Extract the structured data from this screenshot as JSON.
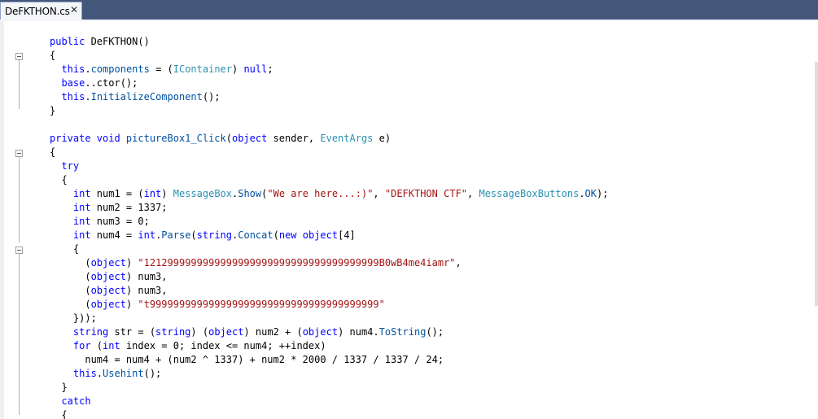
{
  "tab": {
    "title": "DeFKTHON.cs",
    "close_glyph": "✕"
  },
  "code_lines": [
    [
      {
        "c": "kw",
        "t": "public "
      },
      {
        "c": "",
        "t": "DeFKTHON()"
      }
    ],
    [
      {
        "c": "",
        "t": "{"
      }
    ],
    [
      {
        "c": "kw",
        "t": "  this"
      },
      {
        "c": "",
        "t": "."
      },
      {
        "c": "mem",
        "t": "components"
      },
      {
        "c": "",
        "t": " = ("
      },
      {
        "c": "typ",
        "t": "IContainer"
      },
      {
        "c": "",
        "t": ") "
      },
      {
        "c": "kw",
        "t": "null"
      },
      {
        "c": "",
        "t": ";"
      }
    ],
    [
      {
        "c": "kw",
        "t": "  base"
      },
      {
        "c": "",
        "t": "..ctor();"
      }
    ],
    [
      {
        "c": "kw",
        "t": "  this"
      },
      {
        "c": "",
        "t": "."
      },
      {
        "c": "mem",
        "t": "InitializeComponent"
      },
      {
        "c": "",
        "t": "();"
      }
    ],
    [
      {
        "c": "",
        "t": "}"
      }
    ],
    [
      {
        "c": "",
        "t": ""
      }
    ],
    [
      {
        "c": "kw",
        "t": "private void "
      },
      {
        "c": "mem",
        "t": "pictureBox1_Click"
      },
      {
        "c": "",
        "t": "("
      },
      {
        "c": "kw",
        "t": "object"
      },
      {
        "c": "",
        "t": " sender, "
      },
      {
        "c": "typ",
        "t": "EventArgs"
      },
      {
        "c": "",
        "t": " e)"
      }
    ],
    [
      {
        "c": "",
        "t": "{"
      }
    ],
    [
      {
        "c": "kw",
        "t": "  try"
      }
    ],
    [
      {
        "c": "",
        "t": "  {"
      }
    ],
    [
      {
        "c": "kw",
        "t": "    int"
      },
      {
        "c": "",
        "t": " num1 = ("
      },
      {
        "c": "kw",
        "t": "int"
      },
      {
        "c": "",
        "t": ") "
      },
      {
        "c": "typ",
        "t": "MessageBox"
      },
      {
        "c": "",
        "t": "."
      },
      {
        "c": "mem",
        "t": "Show"
      },
      {
        "c": "",
        "t": "("
      },
      {
        "c": "str",
        "t": "\"We are here...:)\""
      },
      {
        "c": "",
        "t": ", "
      },
      {
        "c": "str",
        "t": "\"DEFKTHON CTF\""
      },
      {
        "c": "",
        "t": ", "
      },
      {
        "c": "typ",
        "t": "MessageBoxButtons"
      },
      {
        "c": "",
        "t": "."
      },
      {
        "c": "mem",
        "t": "OK"
      },
      {
        "c": "",
        "t": ");"
      }
    ],
    [
      {
        "c": "kw",
        "t": "    int"
      },
      {
        "c": "",
        "t": " num2 = 1337;"
      }
    ],
    [
      {
        "c": "kw",
        "t": "    int"
      },
      {
        "c": "",
        "t": " num3 = 0;"
      }
    ],
    [
      {
        "c": "kw",
        "t": "    int"
      },
      {
        "c": "",
        "t": " num4 = "
      },
      {
        "c": "kw",
        "t": "int"
      },
      {
        "c": "",
        "t": "."
      },
      {
        "c": "mem",
        "t": "Parse"
      },
      {
        "c": "",
        "t": "("
      },
      {
        "c": "kw",
        "t": "string"
      },
      {
        "c": "",
        "t": "."
      },
      {
        "c": "mem",
        "t": "Concat"
      },
      {
        "c": "",
        "t": "("
      },
      {
        "c": "kw",
        "t": "new object"
      },
      {
        "c": "",
        "t": "[4]"
      }
    ],
    [
      {
        "c": "",
        "t": "    {"
      }
    ],
    [
      {
        "c": "",
        "t": "      ("
      },
      {
        "c": "kw",
        "t": "object"
      },
      {
        "c": "",
        "t": ") "
      },
      {
        "c": "str",
        "t": "\"1212999999999999999999999999999999999999B0wB4me4iamr\""
      },
      {
        "c": "",
        "t": ","
      }
    ],
    [
      {
        "c": "",
        "t": "      ("
      },
      {
        "c": "kw",
        "t": "object"
      },
      {
        "c": "",
        "t": ") num3,"
      }
    ],
    [
      {
        "c": "",
        "t": "      ("
      },
      {
        "c": "kw",
        "t": "object"
      },
      {
        "c": "",
        "t": ") num3,"
      }
    ],
    [
      {
        "c": "",
        "t": "      ("
      },
      {
        "c": "kw",
        "t": "object"
      },
      {
        "c": "",
        "t": ") "
      },
      {
        "c": "str",
        "t": "\"t999999999999999999999999999999999999999\""
      }
    ],
    [
      {
        "c": "",
        "t": "    }));"
      }
    ],
    [
      {
        "c": "kw",
        "t": "    string"
      },
      {
        "c": "",
        "t": " str = ("
      },
      {
        "c": "kw",
        "t": "string"
      },
      {
        "c": "",
        "t": ") ("
      },
      {
        "c": "kw",
        "t": "object"
      },
      {
        "c": "",
        "t": ") num2 + ("
      },
      {
        "c": "kw",
        "t": "object"
      },
      {
        "c": "",
        "t": ") num4."
      },
      {
        "c": "mem",
        "t": "ToString"
      },
      {
        "c": "",
        "t": "();"
      }
    ],
    [
      {
        "c": "kw",
        "t": "    for"
      },
      {
        "c": "",
        "t": " ("
      },
      {
        "c": "kw",
        "t": "int"
      },
      {
        "c": "",
        "t": " index = 0; index <= num4; ++index)"
      }
    ],
    [
      {
        "c": "",
        "t": "      num4 = num4 + (num2 ^ 1337) + num2 * 2000 / 1337 / 1337 / 24;"
      }
    ],
    [
      {
        "c": "kw",
        "t": "    this"
      },
      {
        "c": "",
        "t": "."
      },
      {
        "c": "mem",
        "t": "Usehint"
      },
      {
        "c": "",
        "t": "();"
      }
    ],
    [
      {
        "c": "",
        "t": "  }"
      }
    ],
    [
      {
        "c": "kw",
        "t": "  catch"
      }
    ],
    [
      {
        "c": "",
        "t": "  {"
      }
    ]
  ]
}
